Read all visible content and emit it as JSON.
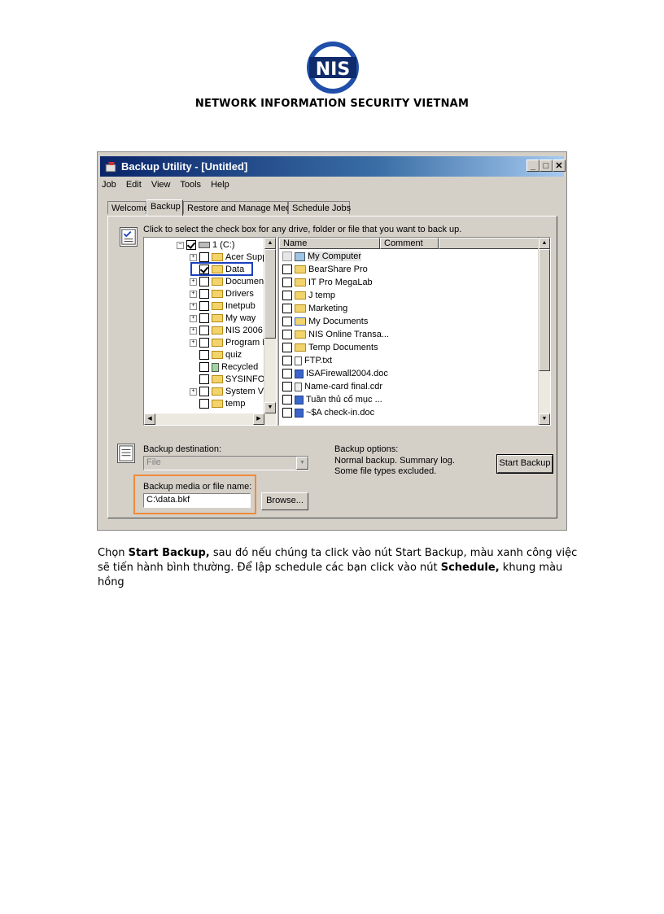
{
  "header": {
    "logo_text": "NIS",
    "org_name": "NETWORK INFORMATION SECURITY VIETNAM"
  },
  "window": {
    "title": "Backup Utility - [Untitled]",
    "buttons": [
      "_",
      "□",
      "✕"
    ],
    "menu": [
      "Job",
      "Edit",
      "View",
      "Tools",
      "Help"
    ],
    "tabs": [
      "Welcome",
      "Backup",
      "Restore and Manage Media",
      "Schedule Jobs"
    ],
    "instruction": "Click to select the check box for any drive, folder or file that you want to back up.",
    "tree_root": "1 (C:)",
    "tree_items": [
      "Acer Supp",
      "Data",
      "Documen",
      "Drivers",
      "Inetpub",
      "My way",
      "NIS 2006",
      "Program F",
      "quiz",
      "Recycled",
      "SYSINFO",
      "System Vo",
      "temp"
    ],
    "list_columns": [
      "Name",
      "Comment"
    ],
    "list_items": [
      "My Computer",
      "BearShare Pro",
      "IT Pro MegaLab",
      "J temp",
      "Marketing",
      "My Documents",
      "NIS Online Transa...",
      "Temp Documents",
      "FTP.txt",
      "ISAFirewall2004.doc",
      "Name-card final.cdr",
      "Tuần thủ cổ mục ...",
      "~$A check-in.doc"
    ],
    "backup_destination_label": "Backup destination:",
    "backup_destination_value": "File",
    "backup_options_label": "Backup options:",
    "backup_options_line1": "Normal backup.  Summary log.",
    "backup_options_line2": "Some file types excluded.",
    "start_backup_label": "Start Backup",
    "media_label": "Backup media or file name:",
    "media_value": "C:\\data.bkf",
    "browse_label": "Browse..."
  },
  "caption": {
    "p1": "Chọn ",
    "b1": "Start Backup,",
    "p2": " sau đó nếu chúng ta click vào nút Start Backup, màu xanh công việc sẽ tiến hành bình thường. Để lập schedule các bạn click vào nút ",
    "b2": "Schedule,",
    "p3": " khung màu hồng"
  },
  "colors": {
    "logo_blue": "#1f4fa8",
    "logo_navy": "#0f2b6b",
    "highlight_orange": "#f08a3a",
    "selection_blue": "#1a3fbf"
  }
}
